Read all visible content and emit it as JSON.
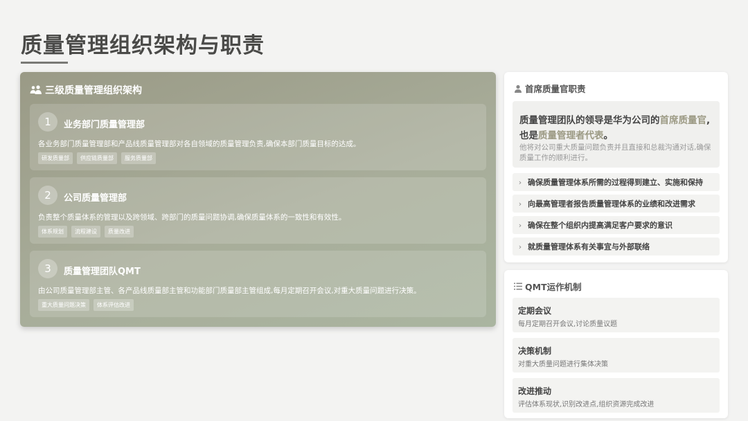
{
  "page": {
    "title": "质量管理组织架构与职责"
  },
  "structure": {
    "header": "三级质量管理组织架构",
    "levels": [
      {
        "num": "1",
        "title": "业务部门质量管理部",
        "desc": "各业务部门质量管理部和产品线质量管理部对各自领域的质量管理负责,确保本部门质量目标的达成。",
        "tags": [
          "研发质量部",
          "供应链质量部",
          "服务质量部"
        ]
      },
      {
        "num": "2",
        "title": "公司质量管理部",
        "desc": "负责整个质量体系的管理以及跨领域、跨部门的质量问题协调,确保质量体系的一致性和有效性。",
        "tags": [
          "体系规划",
          "流程建设",
          "质量改进"
        ]
      },
      {
        "num": "3",
        "title": "质量管理团队QMT",
        "desc": "由公司质量管理部主管、各产品线质量部主管和功能部门质量部主管组成,每月定期召开会议,对重大质量问题进行决策。",
        "tags": [
          "重大质量问题决策",
          "体系评估改进"
        ]
      }
    ]
  },
  "cqo": {
    "header": "首席质量官职责",
    "line1_pre": "质量管理团队的领导是华为公司的",
    "line1_hl": "首席质量官",
    "line1_post": ",",
    "line2_pre": "也是",
    "line2_hl": "质量管理者代表",
    "line2_post": "。",
    "sub": "他将对公司重大质量问题负责并且直接和总裁沟通对话,确保质量工作的顺利进行。",
    "duties": [
      "确保质量管理体系所需的过程得到建立、实施和保持",
      "向最高管理者报告质量管理体系的业绩和改进需求",
      "确保在整个组织内提高满足客户要求的意识",
      "就质量管理体系有关事宜与外部联络"
    ]
  },
  "qmt": {
    "header": "QMT运作机制",
    "items": [
      {
        "title": "定期会议",
        "desc": "每月定期召开会议,讨论质量议题"
      },
      {
        "title": "决策机制",
        "desc": "对重大质量问题进行集体决策"
      },
      {
        "title": "改进推动",
        "desc": "评估体系现状,识别改进点,组织资源完成改进"
      }
    ]
  },
  "colors": {
    "accent": "#9c9a84",
    "panel": "#a8ad9a"
  },
  "icons": {
    "structure": "users-icon",
    "cqo": "user-icon",
    "qmt": "list-icon",
    "duty": "chevron-right-icon"
  }
}
